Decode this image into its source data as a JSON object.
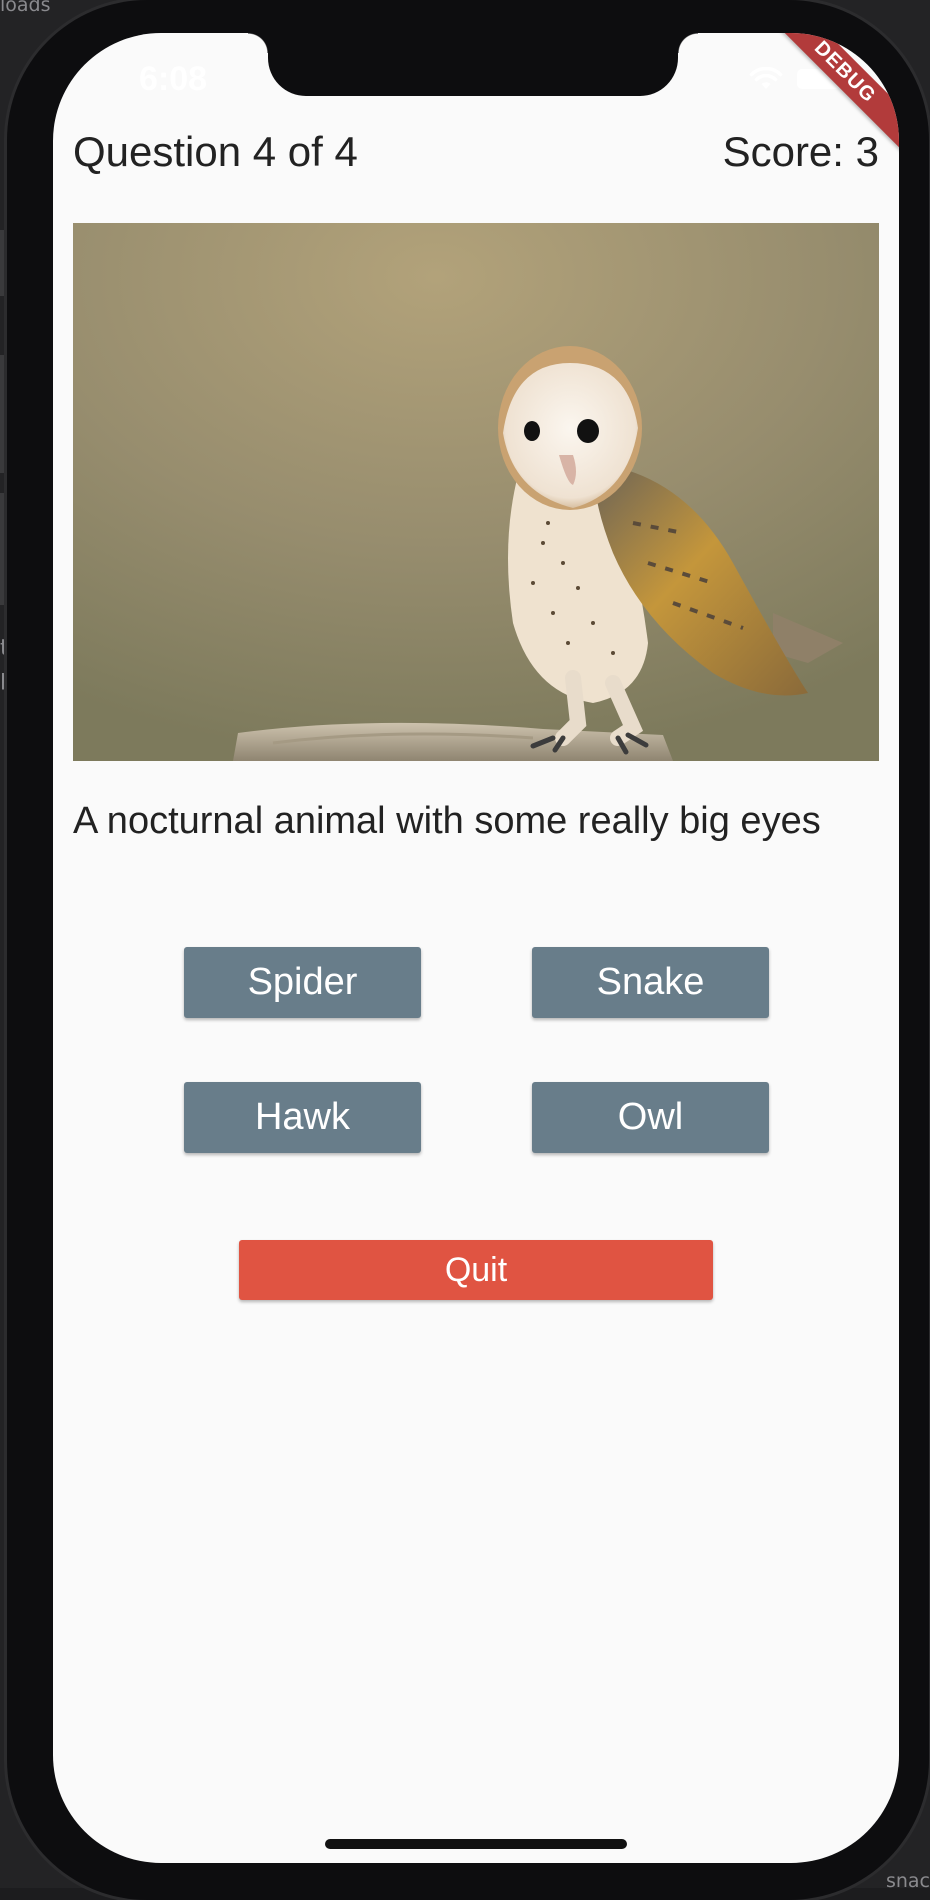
{
  "desktop": {
    "top_fragment": "loads",
    "bottom_fragment": "snac",
    "left_fragment_1": "t",
    "left_fragment_2": "p"
  },
  "status_bar": {
    "time": "6:08",
    "wifi_icon": "wifi-icon",
    "battery_icon": "battery-icon"
  },
  "debug_banner": "DEBUG",
  "quiz": {
    "question_progress": "Question 4 of 4",
    "score": "Score: 3",
    "image_subject": "owl-photo",
    "prompt": "A nocturnal animal with some really big eyes",
    "answers": [
      "Spider",
      "Snake",
      "Hawk",
      "Owl"
    ],
    "quit_label": "Quit"
  },
  "colors": {
    "answer_button": "#687d8a",
    "quit_button": "#e05442",
    "screen_background": "#fafafa",
    "debug_ribbon": "#b23b3b"
  }
}
